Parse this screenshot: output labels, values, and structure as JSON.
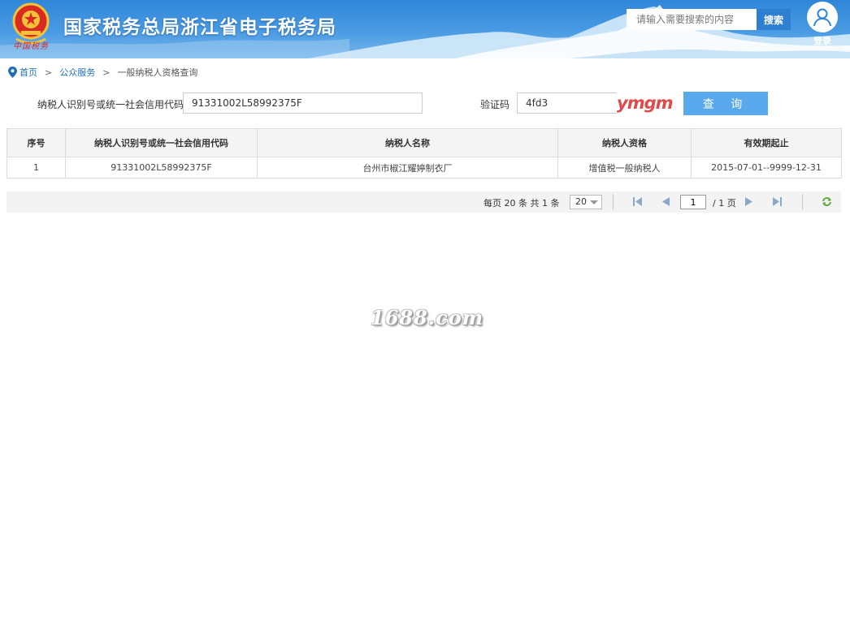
{
  "header": {
    "site_title": "国家税务总局浙江省电子税务局",
    "emblem_signature": "中国税务",
    "search_placeholder": "请输入需要搜索的内容",
    "search_button": "搜索",
    "login_label": "登录"
  },
  "breadcrumb": {
    "items": [
      "首页",
      "公众服务",
      "一般纳税人资格查询"
    ],
    "separator": ">"
  },
  "form": {
    "taxpayer_id_label": "纳税人识别号或统一社会信用代码",
    "taxpayer_id_value": "91331002L58992375F",
    "captcha_label": "验证码",
    "captcha_input_value": "4fd3",
    "captcha_image_text": "ymgm",
    "query_button": "查 询"
  },
  "table": {
    "columns": [
      "序号",
      "纳税人识别号或统一社会信用代码",
      "纳税人名称",
      "纳税人资格",
      "有效期起止"
    ],
    "rows": [
      [
        "1",
        "91331002L58992375F",
        "台州市椒江耀婷制衣厂",
        "增值税一般纳税人",
        "2015-07-01--9999-12-31"
      ]
    ]
  },
  "pagination": {
    "info": "每页 20 条 共 1 条",
    "page_size": "20",
    "current_page": "1",
    "total_pages": "/ 1 页"
  },
  "watermark": "1688.com",
  "colors": {
    "header_blue": "#2f86d8",
    "query_button": "#5aa9ec",
    "link": "#1f6ebd",
    "search_button": "#2d7fd2"
  }
}
